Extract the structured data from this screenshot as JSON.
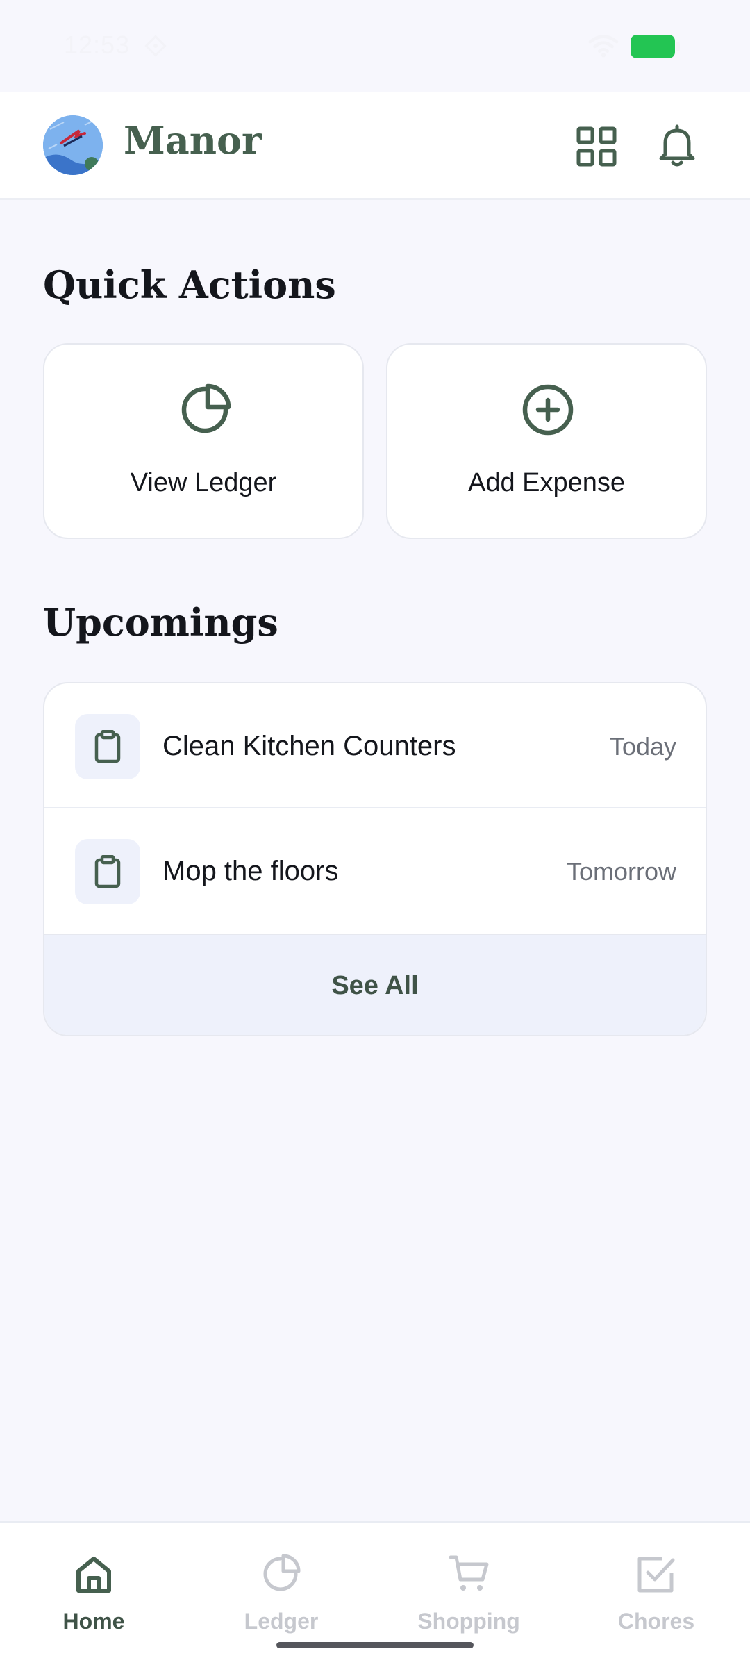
{
  "status_bar": {
    "time": "12:53"
  },
  "app_bar": {
    "title": "Manor"
  },
  "quick_actions": {
    "title": "Quick Actions",
    "items": [
      {
        "label": "View Ledger",
        "icon": "pie-chart-icon"
      },
      {
        "label": "Add Expense",
        "icon": "plus-circle-icon"
      }
    ]
  },
  "upcomings": {
    "title": "Upcomings",
    "items": [
      {
        "label": "Clean Kitchen Counters",
        "date": "Today",
        "icon": "clipboard-icon"
      },
      {
        "label": "Mop the floors",
        "date": "Tomorrow",
        "icon": "clipboard-icon"
      }
    ],
    "see_all_label": "See All"
  },
  "bottom_nav": {
    "items": [
      {
        "label": "Home",
        "icon": "home-icon",
        "active": true
      },
      {
        "label": "Ledger",
        "icon": "pie-chart-icon",
        "active": false
      },
      {
        "label": "Shopping",
        "icon": "cart-icon",
        "active": false
      },
      {
        "label": "Chores",
        "icon": "checkbox-icon",
        "active": false
      }
    ]
  },
  "colors": {
    "accent": "#46604f",
    "background": "#f7f7fd",
    "card": "#ffffff",
    "inactive": "#c6c8ce",
    "battery": "#23c553"
  }
}
